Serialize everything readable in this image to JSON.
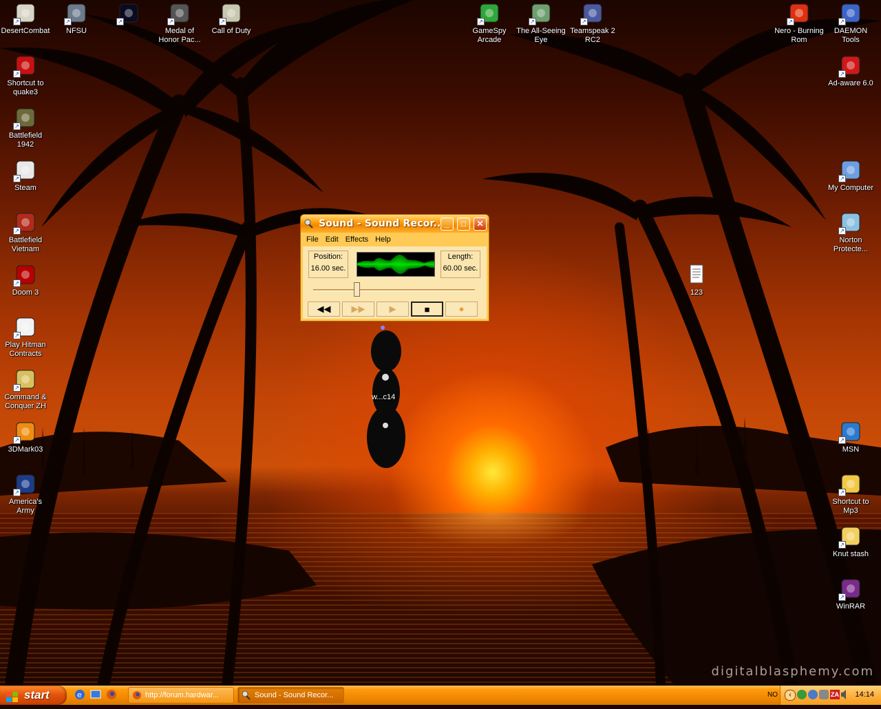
{
  "desktop": {
    "watermark": "digitalblasphemy.com",
    "icons_left": [
      {
        "label": "DesertCombat",
        "icon": "desert-combat-icon",
        "color": "#d9d4c8"
      },
      {
        "label": "Shortcut to quake3",
        "icon": "quake3-icon",
        "color": "#c81010"
      },
      {
        "label": "Battlefield 1942",
        "icon": "battlefield-1942-icon",
        "color": "#6d6a3a"
      },
      {
        "label": "Steam",
        "icon": "steam-icon",
        "color": "#e8e8e8"
      },
      {
        "label": "Battlefield Vietnam",
        "icon": "battlefield-vietnam-icon",
        "color": "#b32a1a"
      },
      {
        "label": "Doom 3",
        "icon": "doom3-icon",
        "color": "#b80000"
      },
      {
        "label": "Play Hitman Contracts",
        "icon": "hitman-contracts-icon",
        "color": "#f2f2f2"
      },
      {
        "label": "Command & Conquer ZH",
        "icon": "command-conquer-icon",
        "color": "#d8c060"
      },
      {
        "label": "3DMark03",
        "icon": "3dmark03-icon",
        "color": "#f08c10"
      },
      {
        "label": "America's Army",
        "icon": "americas-army-icon",
        "color": "#1c3c8a"
      }
    ],
    "icons_top": [
      {
        "label": "NFSU",
        "icon": "nfsu-icon",
        "color": "#6b7a8c"
      },
      {
        "label": "",
        "icon": "starfield-icon",
        "color": "#0a0a20"
      },
      {
        "label": "Medal of Honor Pac...",
        "icon": "medal-of-honor-icon",
        "color": "#555555"
      },
      {
        "label": "Call of Duty",
        "icon": "call-of-duty-icon",
        "color": "#c8c8b0"
      },
      {
        "label": "GameSpy Arcade",
        "icon": "gamespy-arcade-icon",
        "color": "#2fa63a"
      },
      {
        "label": "The All-Seeing Eye",
        "icon": "all-seeing-eye-icon",
        "color": "#6ea06e"
      },
      {
        "label": "Teamspeak 2 RC2",
        "icon": "teamspeak-icon",
        "color": "#4a5aa0"
      }
    ],
    "icons_right": [
      {
        "label": "Nero - Burning Rom",
        "icon": "nero-icon",
        "color": "#e03010"
      },
      {
        "label": "DAEMON Tools",
        "icon": "daemon-tools-icon",
        "color": "#3c64c8"
      },
      {
        "label": "Ad-aware 6.0",
        "icon": "ad-aware-icon",
        "color": "#d01818"
      },
      {
        "label": "My Computer",
        "icon": "my-computer-icon",
        "color": "#6e9ee0"
      },
      {
        "label": "Norton Protecte...",
        "icon": "recycle-bin-icon",
        "color": "#8cc0e0"
      },
      {
        "label": "MSN",
        "icon": "msn-icon",
        "color": "#2a7ad0"
      },
      {
        "label": "Shortcut to Mp3",
        "icon": "folder-icon",
        "color": "#f2c845"
      },
      {
        "label": "Knut stash",
        "icon": "folder-envelope-icon",
        "color": "#f2d060"
      },
      {
        "label": "WinRAR",
        "icon": "winrar-icon",
        "color": "#7a2a8a"
      }
    ],
    "icon_123": {
      "label": "123",
      "icon": "text-document-icon"
    },
    "icon_ghost": {
      "label": "w...c14",
      "icon": "corrupted-icon"
    }
  },
  "window": {
    "title": "Sound - Sound Recor...",
    "menu": [
      "File",
      "Edit",
      "Effects",
      "Help"
    ],
    "position_label": "Position:",
    "position_value": "16.00 sec.",
    "length_label": "Length:",
    "length_value": "60.00 sec.",
    "seek_fraction": 0.267,
    "buttons": {
      "rewind": "◀◀",
      "forward": "▶▶",
      "play": "▶",
      "stop": "■",
      "record": "●"
    },
    "wave_color": "#00e000"
  },
  "taskbar": {
    "start_label": "start",
    "tasks": [
      {
        "label": "http://forum.hardwar...",
        "icon": "firefox-icon"
      },
      {
        "label": "Sound - Sound Recor...",
        "icon": "sound-recorder-icon"
      }
    ],
    "language": "NO",
    "clock": "14:14"
  }
}
